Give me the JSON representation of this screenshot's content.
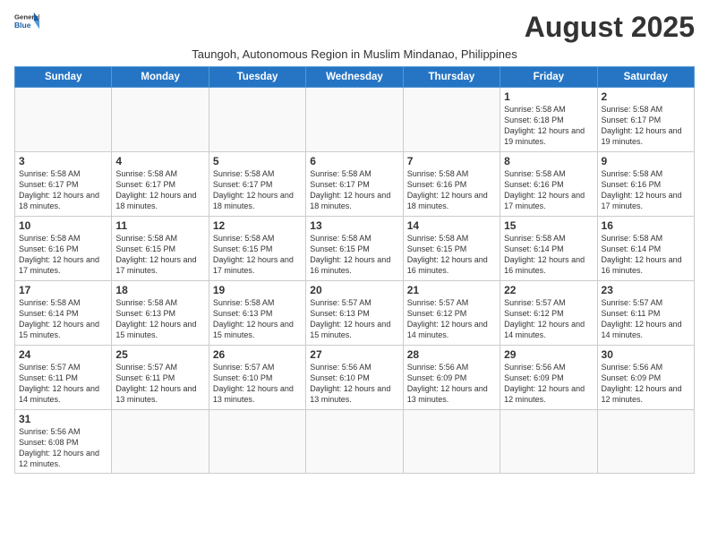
{
  "header": {
    "logo_line1": "General",
    "logo_line2": "Blue",
    "month_title": "August 2025",
    "subtitle": "Taungoh, Autonomous Region in Muslim Mindanao, Philippines"
  },
  "days_of_week": [
    "Sunday",
    "Monday",
    "Tuesday",
    "Wednesday",
    "Thursday",
    "Friday",
    "Saturday"
  ],
  "weeks": [
    [
      {
        "day": "",
        "info": ""
      },
      {
        "day": "",
        "info": ""
      },
      {
        "day": "",
        "info": ""
      },
      {
        "day": "",
        "info": ""
      },
      {
        "day": "",
        "info": ""
      },
      {
        "day": "1",
        "info": "Sunrise: 5:58 AM\nSunset: 6:18 PM\nDaylight: 12 hours and 19 minutes."
      },
      {
        "day": "2",
        "info": "Sunrise: 5:58 AM\nSunset: 6:17 PM\nDaylight: 12 hours and 19 minutes."
      }
    ],
    [
      {
        "day": "3",
        "info": "Sunrise: 5:58 AM\nSunset: 6:17 PM\nDaylight: 12 hours and 18 minutes."
      },
      {
        "day": "4",
        "info": "Sunrise: 5:58 AM\nSunset: 6:17 PM\nDaylight: 12 hours and 18 minutes."
      },
      {
        "day": "5",
        "info": "Sunrise: 5:58 AM\nSunset: 6:17 PM\nDaylight: 12 hours and 18 minutes."
      },
      {
        "day": "6",
        "info": "Sunrise: 5:58 AM\nSunset: 6:17 PM\nDaylight: 12 hours and 18 minutes."
      },
      {
        "day": "7",
        "info": "Sunrise: 5:58 AM\nSunset: 6:16 PM\nDaylight: 12 hours and 18 minutes."
      },
      {
        "day": "8",
        "info": "Sunrise: 5:58 AM\nSunset: 6:16 PM\nDaylight: 12 hours and 17 minutes."
      },
      {
        "day": "9",
        "info": "Sunrise: 5:58 AM\nSunset: 6:16 PM\nDaylight: 12 hours and 17 minutes."
      }
    ],
    [
      {
        "day": "10",
        "info": "Sunrise: 5:58 AM\nSunset: 6:16 PM\nDaylight: 12 hours and 17 minutes."
      },
      {
        "day": "11",
        "info": "Sunrise: 5:58 AM\nSunset: 6:15 PM\nDaylight: 12 hours and 17 minutes."
      },
      {
        "day": "12",
        "info": "Sunrise: 5:58 AM\nSunset: 6:15 PM\nDaylight: 12 hours and 17 minutes."
      },
      {
        "day": "13",
        "info": "Sunrise: 5:58 AM\nSunset: 6:15 PM\nDaylight: 12 hours and 16 minutes."
      },
      {
        "day": "14",
        "info": "Sunrise: 5:58 AM\nSunset: 6:15 PM\nDaylight: 12 hours and 16 minutes."
      },
      {
        "day": "15",
        "info": "Sunrise: 5:58 AM\nSunset: 6:14 PM\nDaylight: 12 hours and 16 minutes."
      },
      {
        "day": "16",
        "info": "Sunrise: 5:58 AM\nSunset: 6:14 PM\nDaylight: 12 hours and 16 minutes."
      }
    ],
    [
      {
        "day": "17",
        "info": "Sunrise: 5:58 AM\nSunset: 6:14 PM\nDaylight: 12 hours and 15 minutes."
      },
      {
        "day": "18",
        "info": "Sunrise: 5:58 AM\nSunset: 6:13 PM\nDaylight: 12 hours and 15 minutes."
      },
      {
        "day": "19",
        "info": "Sunrise: 5:58 AM\nSunset: 6:13 PM\nDaylight: 12 hours and 15 minutes."
      },
      {
        "day": "20",
        "info": "Sunrise: 5:57 AM\nSunset: 6:13 PM\nDaylight: 12 hours and 15 minutes."
      },
      {
        "day": "21",
        "info": "Sunrise: 5:57 AM\nSunset: 6:12 PM\nDaylight: 12 hours and 14 minutes."
      },
      {
        "day": "22",
        "info": "Sunrise: 5:57 AM\nSunset: 6:12 PM\nDaylight: 12 hours and 14 minutes."
      },
      {
        "day": "23",
        "info": "Sunrise: 5:57 AM\nSunset: 6:11 PM\nDaylight: 12 hours and 14 minutes."
      }
    ],
    [
      {
        "day": "24",
        "info": "Sunrise: 5:57 AM\nSunset: 6:11 PM\nDaylight: 12 hours and 14 minutes."
      },
      {
        "day": "25",
        "info": "Sunrise: 5:57 AM\nSunset: 6:11 PM\nDaylight: 12 hours and 13 minutes."
      },
      {
        "day": "26",
        "info": "Sunrise: 5:57 AM\nSunset: 6:10 PM\nDaylight: 12 hours and 13 minutes."
      },
      {
        "day": "27",
        "info": "Sunrise: 5:56 AM\nSunset: 6:10 PM\nDaylight: 12 hours and 13 minutes."
      },
      {
        "day": "28",
        "info": "Sunrise: 5:56 AM\nSunset: 6:09 PM\nDaylight: 12 hours and 13 minutes."
      },
      {
        "day": "29",
        "info": "Sunrise: 5:56 AM\nSunset: 6:09 PM\nDaylight: 12 hours and 12 minutes."
      },
      {
        "day": "30",
        "info": "Sunrise: 5:56 AM\nSunset: 6:09 PM\nDaylight: 12 hours and 12 minutes."
      }
    ],
    [
      {
        "day": "31",
        "info": "Sunrise: 5:56 AM\nSunset: 6:08 PM\nDaylight: 12 hours and 12 minutes."
      },
      {
        "day": "",
        "info": ""
      },
      {
        "day": "",
        "info": ""
      },
      {
        "day": "",
        "info": ""
      },
      {
        "day": "",
        "info": ""
      },
      {
        "day": "",
        "info": ""
      },
      {
        "day": "",
        "info": ""
      }
    ]
  ]
}
